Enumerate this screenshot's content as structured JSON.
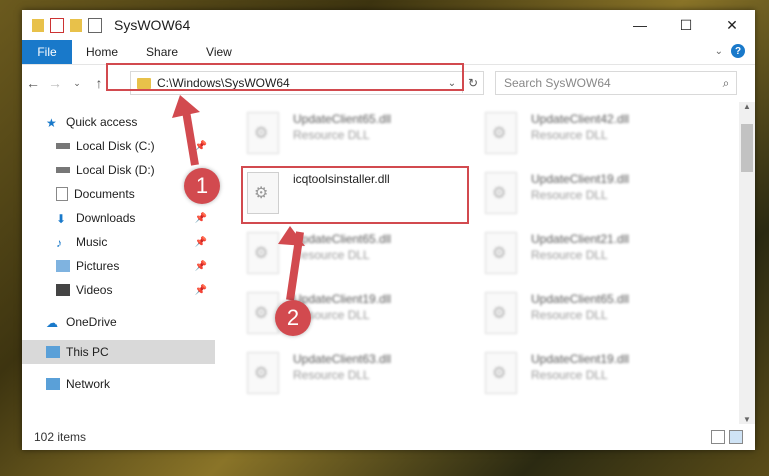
{
  "window": {
    "title": "SysWOW64"
  },
  "ribbon": {
    "file": "File",
    "tabs": [
      "Home",
      "Share",
      "View"
    ],
    "help": "?"
  },
  "address": {
    "path": "C:\\Windows\\SysWOW64"
  },
  "search": {
    "placeholder": "Search SysWOW64"
  },
  "nav": {
    "items": [
      {
        "label": "Quick access"
      },
      {
        "label": "Local Disk (C:)"
      },
      {
        "label": "Local Disk (D:)"
      },
      {
        "label": "Documents"
      },
      {
        "label": "Downloads"
      },
      {
        "label": "Music"
      },
      {
        "label": "Pictures"
      },
      {
        "label": "Videos"
      },
      {
        "label": "OneDrive"
      },
      {
        "label": "This PC"
      },
      {
        "label": "Network"
      }
    ]
  },
  "files": [
    {
      "name": "UpdateClient65.dll",
      "type": "Resource DLL"
    },
    {
      "name": "UpdateClient42.dll",
      "type": "Resource DLL"
    },
    {
      "name": "icqtoolsinstaller.dll",
      "type": ""
    },
    {
      "name": "UpdateClient19.dll",
      "type": "Resource DLL"
    },
    {
      "name": "UpdateClient65.dll",
      "type": "Resource DLL"
    },
    {
      "name": "UpdateClient21.dll",
      "type": "Resource DLL"
    },
    {
      "name": "UpdateClient19.dll",
      "type": "Resource DLL"
    },
    {
      "name": "UpdateClient65.dll",
      "type": "Resource DLL"
    },
    {
      "name": "UpdateClient63.dll",
      "type": "Resource DLL"
    },
    {
      "name": "UpdateClient19.dll",
      "type": "Resource DLL"
    }
  ],
  "status": {
    "count": "102 items"
  },
  "markers": {
    "one": "1",
    "two": "2"
  },
  "colors": {
    "accent": "#1979ca",
    "highlight": "#d24a4f"
  }
}
